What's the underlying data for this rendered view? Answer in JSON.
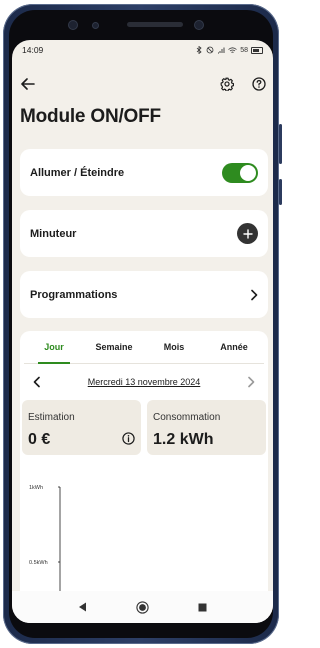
{
  "status_bar": {
    "time": "14:09",
    "battery": "58"
  },
  "page": {
    "title": "Module ON/OFF"
  },
  "rows": {
    "power": {
      "label": "Allumer / Éteindre",
      "on": true
    },
    "timer": {
      "label": "Minuteur"
    },
    "schedules": {
      "label": "Programmations"
    }
  },
  "tabs": [
    {
      "label": "Jour",
      "active": true
    },
    {
      "label": "Semaine",
      "active": false
    },
    {
      "label": "Mois",
      "active": false
    },
    {
      "label": "Année",
      "active": false
    }
  ],
  "date": {
    "label": "Mercredi 13 novembre 2024"
  },
  "tiles": {
    "estimation": {
      "label": "Estimation",
      "value": "0 €"
    },
    "consumption": {
      "label": "Consommation",
      "value": "1.2 kWh"
    }
  },
  "chart": {
    "y_ticks": [
      "1kWh",
      "0.5kWh"
    ]
  },
  "colors": {
    "accent": "#2e8b1f",
    "background": "#f3f0ea",
    "card": "#ffffff",
    "tile": "#efebe3"
  },
  "icons": [
    "back-arrow-icon",
    "gear-icon",
    "help-icon",
    "toggle-switch",
    "plus-icon",
    "chevron-right-icon",
    "chevron-left-icon",
    "info-icon",
    "nav-back-icon",
    "nav-home-icon",
    "nav-recents-icon"
  ]
}
